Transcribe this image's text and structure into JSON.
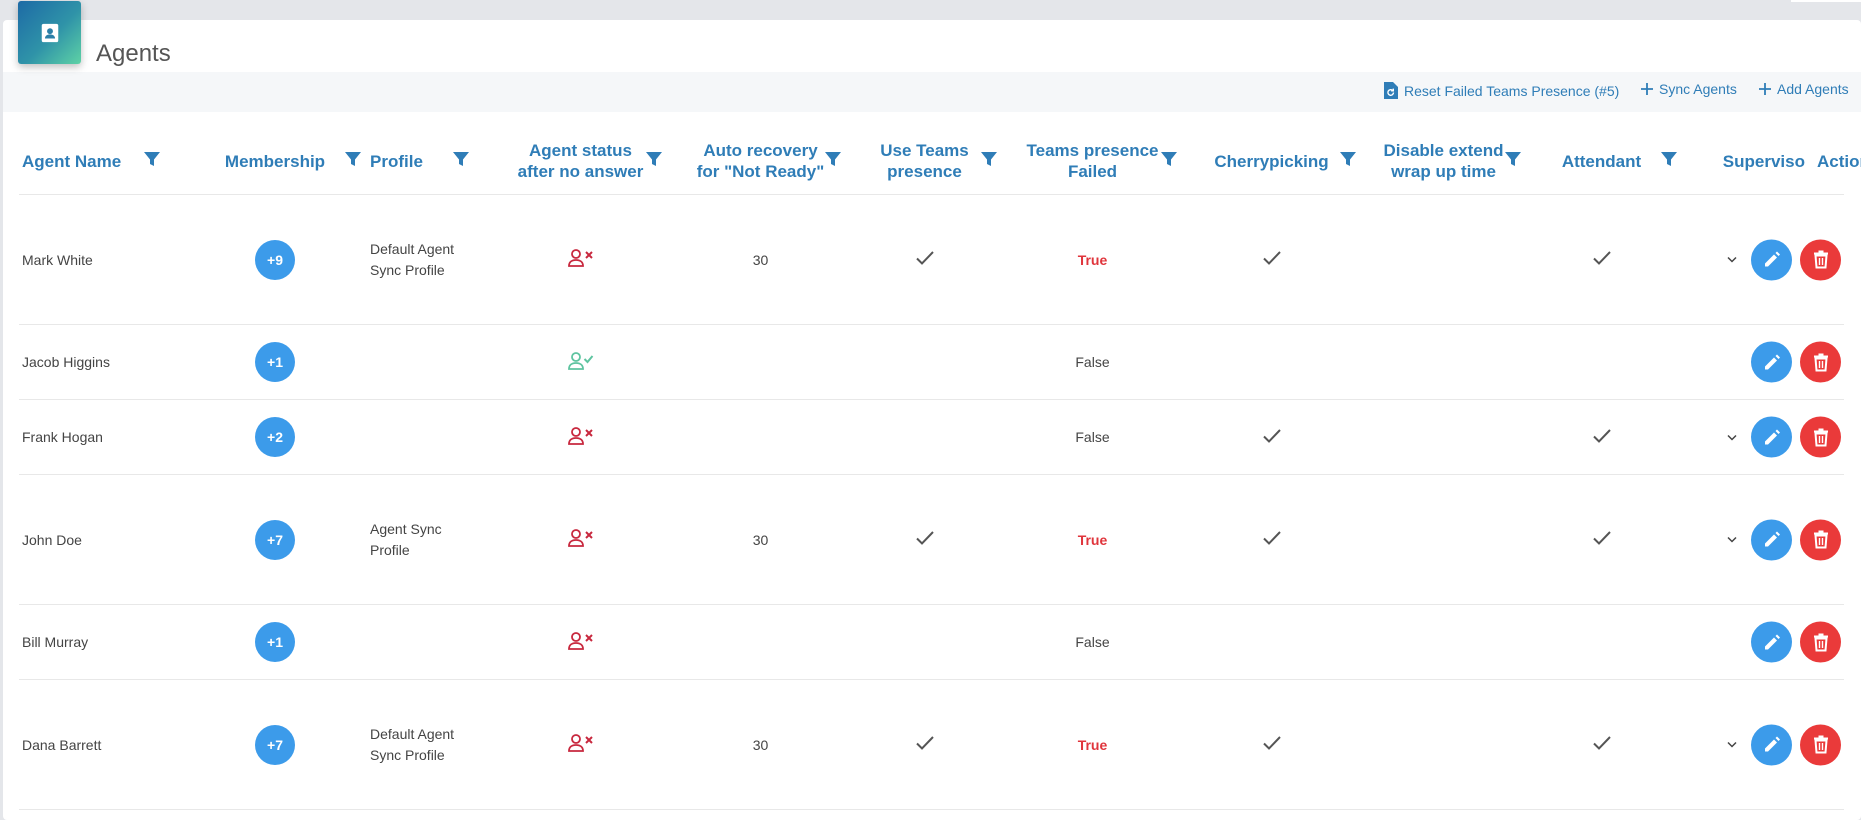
{
  "page": {
    "title": "Agents"
  },
  "toolbar": {
    "reset_label": "Reset Failed Teams Presence (#5)",
    "sync_label": "Sync Agents",
    "add_label": "Add Agents"
  },
  "columns": {
    "agent_name": "Agent Name",
    "membership": "Membership",
    "profile": "Profile",
    "status_line1": "Agent status",
    "status_line2": "after no answer",
    "recovery_line1": "Auto recovery",
    "recovery_line2": "for \"Not Ready\"",
    "teams_line1": "Use Teams",
    "teams_line2": "presence",
    "failed_line1": "Teams presence",
    "failed_line2": "Failed",
    "cherry": "Cherrypicking",
    "wrap_line1": "Disable extend",
    "wrap_line2": "wrap up time",
    "attendant": "Attendant",
    "supervisor": "Superviso",
    "actions": "Actions"
  },
  "colors": {
    "accent": "#2f7db7",
    "badge": "#3c9bea",
    "edit": "#3c9bea",
    "delete": "#ea3a3a",
    "error": "#e0353c",
    "ok_icon": "#5ec4a0",
    "no_icon": "#c8283e"
  },
  "rows": [
    {
      "name": "Mark White",
      "membership": "+9",
      "profile_line1": "Default Agent",
      "profile_line2": "Sync Profile",
      "status_icon": "person-remove-icon",
      "recovery": "30",
      "use_teams": true,
      "failed": "True",
      "cherry": true,
      "wrap": false,
      "attendant": true,
      "supervisor_chevron": true
    },
    {
      "name": "Jacob Higgins",
      "membership": "+1",
      "profile_line1": "",
      "profile_line2": "",
      "status_icon": "person-check-icon",
      "recovery": "",
      "use_teams": false,
      "failed": "False",
      "cherry": false,
      "wrap": false,
      "attendant": false,
      "supervisor_chevron": false
    },
    {
      "name": "Frank Hogan",
      "membership": "+2",
      "profile_line1": "",
      "profile_line2": "",
      "status_icon": "person-remove-icon",
      "recovery": "",
      "use_teams": false,
      "failed": "False",
      "cherry": true,
      "wrap": false,
      "attendant": true,
      "supervisor_chevron": true
    },
    {
      "name": "John Doe",
      "membership": "+7",
      "profile_line1": "Agent Sync",
      "profile_line2": "Profile",
      "status_icon": "person-remove-icon",
      "recovery": "30",
      "use_teams": true,
      "failed": "True",
      "cherry": true,
      "wrap": false,
      "attendant": true,
      "supervisor_chevron": true
    },
    {
      "name": "Bill Murray",
      "membership": "+1",
      "profile_line1": "",
      "profile_line2": "",
      "status_icon": "person-remove-icon",
      "recovery": "",
      "use_teams": false,
      "failed": "False",
      "cherry": false,
      "wrap": false,
      "attendant": false,
      "supervisor_chevron": false
    },
    {
      "name": "Dana Barrett",
      "membership": "+7",
      "profile_line1": "Default Agent",
      "profile_line2": "Sync Profile",
      "status_icon": "person-remove-icon",
      "recovery": "30",
      "use_teams": true,
      "failed": "True",
      "cherry": true,
      "wrap": false,
      "attendant": true,
      "supervisor_chevron": true
    }
  ]
}
